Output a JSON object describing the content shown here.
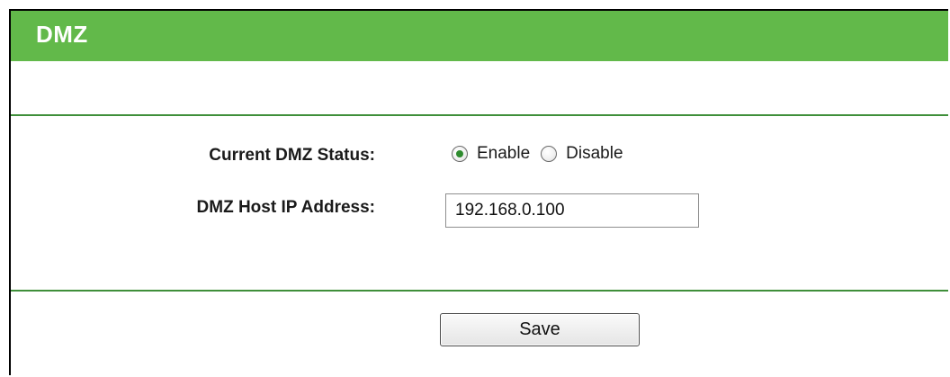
{
  "header": {
    "title": "DMZ"
  },
  "form": {
    "status_label": "Current DMZ Status:",
    "status_options": {
      "enable": "Enable",
      "disable": "Disable",
      "selected": "Enable"
    },
    "ip_label": "DMZ Host IP Address:",
    "ip_value": "192.168.0.100"
  },
  "actions": {
    "save_label": "Save"
  },
  "colors": {
    "header_bg": "#62b94a",
    "divider": "#3f8f3a"
  }
}
